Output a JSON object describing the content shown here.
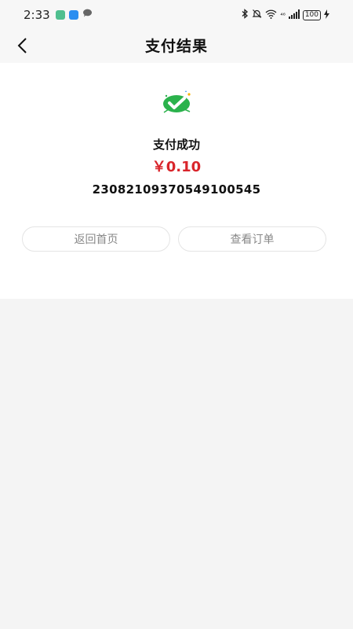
{
  "status_bar": {
    "time": "2:33",
    "battery": "100",
    "network": "⁴⁶",
    "notification_icons": [
      "app-icon",
      "cloud-icon",
      "message-icon"
    ]
  },
  "nav": {
    "title": "支付结果",
    "back_icon": "chevron-left-icon"
  },
  "result": {
    "icon": "check-badge-icon",
    "status": "支付成功",
    "amount": "￥0.10",
    "order_number": "2308210937054910054​5"
  },
  "actions": {
    "home_label": "返回首页",
    "order_label": "查看订单"
  },
  "colors": {
    "accent_red": "#d9252b",
    "success_green": "#2bb24c",
    "page_bg": "#f4f4f4"
  }
}
